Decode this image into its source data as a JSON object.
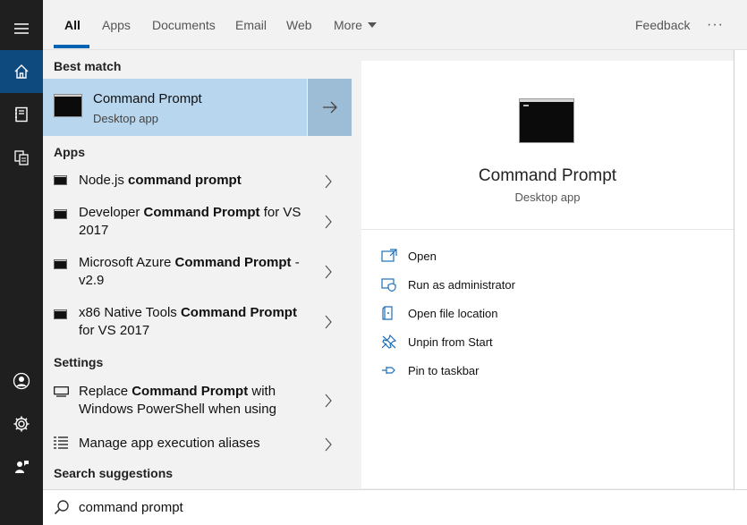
{
  "rail": {
    "items": [
      {
        "name": "hamburger-menu-icon"
      },
      {
        "name": "home-icon"
      },
      {
        "name": "notebook-icon"
      },
      {
        "name": "documents-icon"
      },
      {
        "name": "user-icon"
      },
      {
        "name": "settings-gear-icon"
      },
      {
        "name": "feedback-person-icon"
      }
    ]
  },
  "tabs": [
    {
      "label": "All",
      "active": true
    },
    {
      "label": "Apps"
    },
    {
      "label": "Documents"
    },
    {
      "label": "Email"
    },
    {
      "label": "Web"
    },
    {
      "label": "More"
    }
  ],
  "header": {
    "feedback_label": "Feedback",
    "more_options_label": "···"
  },
  "best_match": {
    "heading": "Best match",
    "title": "Command Prompt",
    "subtitle": "Desktop app"
  },
  "apps": {
    "heading": "Apps",
    "items": [
      {
        "prefix": "Node.js ",
        "bold": "command prompt",
        "suffix": ""
      },
      {
        "prefix": "Developer ",
        "bold": "Command Prompt",
        "suffix": " for VS 2017"
      },
      {
        "prefix": "Microsoft Azure ",
        "bold": "Command Prompt",
        "suffix": " - v2.9"
      },
      {
        "prefix": "x86 Native Tools ",
        "bold": "Command Prompt",
        "suffix": " for VS 2017"
      }
    ]
  },
  "settings": {
    "heading": "Settings",
    "items": [
      {
        "prefix": "Replace ",
        "bold": "Command Prompt",
        "suffix": " with Windows PowerShell when using"
      },
      {
        "prefix": "Manage app execution aliases",
        "bold": "",
        "suffix": ""
      }
    ]
  },
  "suggestions": {
    "heading": "Search suggestions"
  },
  "search": {
    "value": "command prompt"
  },
  "detail": {
    "title": "Command Prompt",
    "subtitle": "Desktop app",
    "actions": [
      {
        "label": "Open",
        "icon": "open-window-icon"
      },
      {
        "label": "Run as administrator",
        "icon": "shield-window-icon"
      },
      {
        "label": "Open file location",
        "icon": "file-location-icon"
      },
      {
        "label": "Unpin from Start",
        "icon": "unpin-icon"
      },
      {
        "label": "Pin to taskbar",
        "icon": "pin-icon"
      }
    ]
  },
  "colors": {
    "accent": "#0063b1",
    "rail_bg": "#1f1f1f",
    "rail_active": "#0e4a7d",
    "best_match_bg": "#b8d6ee",
    "action_icon": "#1e6fb8"
  }
}
